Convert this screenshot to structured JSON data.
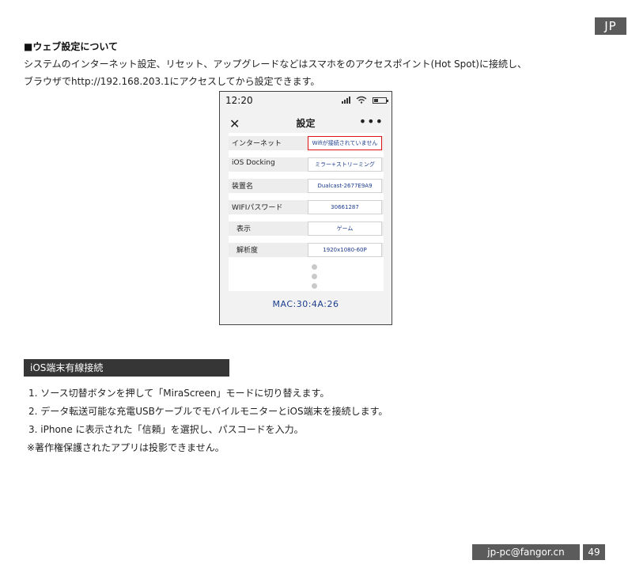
{
  "lang_tab": "JP",
  "web_heading": "■ウェブ設定について",
  "intro": [
    "システムのインターネット設定、リセット、アップグレードなどはスマホをのアクセスポイント(Hot Spot)に接続し、",
    "ブラウザでhttp://192.168.203.1にアクセスしてから設定できます。"
  ],
  "phone": {
    "time": "12:20",
    "title": "設定",
    "close_glyph": "✕",
    "more_glyph": "•••",
    "rows": [
      {
        "label": "インターネット",
        "value": "Wifiが接続されていません"
      },
      {
        "label": "iOS Docking",
        "value": "ミラー+ストリーミング"
      },
      {
        "label": "装置名",
        "value": "Dualcast-2677E9A9"
      },
      {
        "label": "WIFIパスワード",
        "value": "30661287"
      },
      {
        "label": "表示",
        "value": "ゲーム"
      },
      {
        "label": "解析度",
        "value": "1920x1080-60P"
      }
    ],
    "mac": "MAC:30:4A:26"
  },
  "section_title": "iOS端末有線接続",
  "steps": [
    "1. ソース切替ボタンを押して「MiraScreen」モードに切り替えます。",
    "2. データ転送可能な充電USBケーブルでモバイルモニターとiOS端末を接続します。",
    "3. iPhone に表示された「信頼」を選択し、パスコードを入力。"
  ],
  "note": "※著作権保護されたアプリは投影できません。",
  "footer": {
    "email": "jp-pc@fangor.cn",
    "page": "49"
  }
}
